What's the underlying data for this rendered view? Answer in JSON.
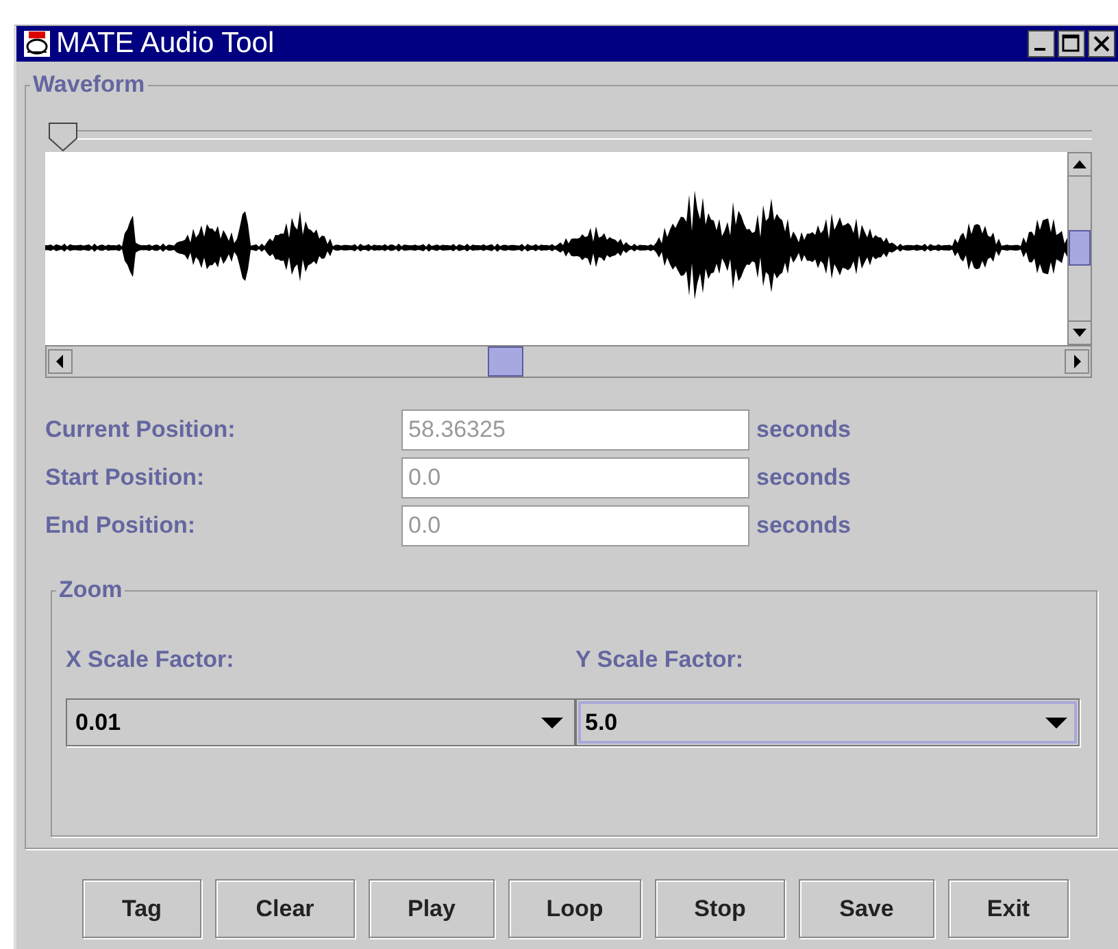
{
  "window": {
    "title": "MATE Audio Tool"
  },
  "waveform": {
    "title": "Waveform",
    "position_slider": {
      "level": 0
    }
  },
  "fields": [
    {
      "label": "Current Position:",
      "value": "58.36325",
      "unit": "seconds",
      "disabled": true
    },
    {
      "label": "Start Position:",
      "value": "0.0",
      "unit": "seconds",
      "disabled": true
    },
    {
      "label": "End Position:",
      "value": "0.0",
      "unit": "seconds",
      "disabled": true
    }
  ],
  "zoom": {
    "title": "Zoom",
    "scales": [
      {
        "label": "X Scale Factor:",
        "value": "0.01",
        "focused": false
      },
      {
        "label": "Y Scale Factor:",
        "value": "5.0",
        "focused": true
      }
    ]
  },
  "buttons": [
    "Tag",
    "Clear",
    "Play",
    "Loop",
    "Stop",
    "Save",
    "Exit"
  ]
}
